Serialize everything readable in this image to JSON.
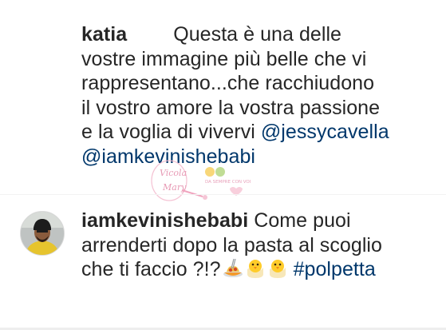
{
  "comments": [
    {
      "username": "katia",
      "lines": [
        "Questa è una delle",
        "vostre immagine più belle che vi",
        "rappresentano...che racchiudono",
        "il vostro amore la vostra passione",
        "e la voglia di vivervi "
      ],
      "mentions": [
        "@jessycavella",
        "@iamkevinishebabi"
      ]
    },
    {
      "username": "iamkevinishebabi",
      "text_parts": [
        "Come puoi",
        "arrenderti dopo la pasta al scoglio",
        "che ti faccio ?!?"
      ],
      "emojis": [
        "spaghetti-icon",
        "hatching-chick-icon",
        "hatching-chick-icon"
      ],
      "hashtag": "#polpetta"
    }
  ],
  "watermark": {
    "text_top": "Vicola",
    "text_bottom": "Mary",
    "tagline": "DA SEMPRE CON VOI"
  },
  "colors": {
    "text": "#262626",
    "link": "#00376b",
    "background": "#ffffff"
  }
}
